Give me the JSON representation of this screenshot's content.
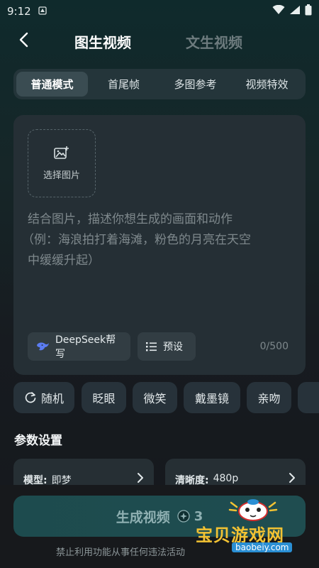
{
  "status_bar": {
    "time": "9:12"
  },
  "header": {
    "back_icon": "chevron-left-icon",
    "tab_active": "图生视频",
    "tab_inactive": "文生视频"
  },
  "modes": {
    "items": [
      "普通模式",
      "首尾帧",
      "多图参考",
      "视频特效"
    ],
    "active": "普通模式"
  },
  "prompt": {
    "upload_label": "选择图片",
    "upload_icon": "image-add-icon",
    "placeholder_line1": "结合图片，描述你想生成的画面和动作",
    "placeholder_line2": "（例：海浪拍打着海滩，粉色的月亮在天空",
    "placeholder_line3": "中缓缓升起）",
    "deepseek_label": "DeepSeek帮写",
    "preset_label": "预设",
    "char_count": "0/500"
  },
  "chips": {
    "random": "随机",
    "items": [
      "眨眼",
      "微笑",
      "戴墨镜",
      "亲吻"
    ]
  },
  "params": {
    "section_title": "参数设置",
    "model_label": "模型:",
    "model_value": "即梦",
    "clarity_label": "清晰度:",
    "clarity_value": "480p"
  },
  "footer": {
    "generate_label": "生成视频",
    "cost": "3",
    "notice": "禁止利用功能从事任何违法活动"
  },
  "watermark": {
    "text": "宝贝游戏网",
    "url": "baobeiy.com"
  },
  "colors": {
    "accent": "#1f4d50",
    "card": "#252f35",
    "watermark": "#f2c233"
  }
}
